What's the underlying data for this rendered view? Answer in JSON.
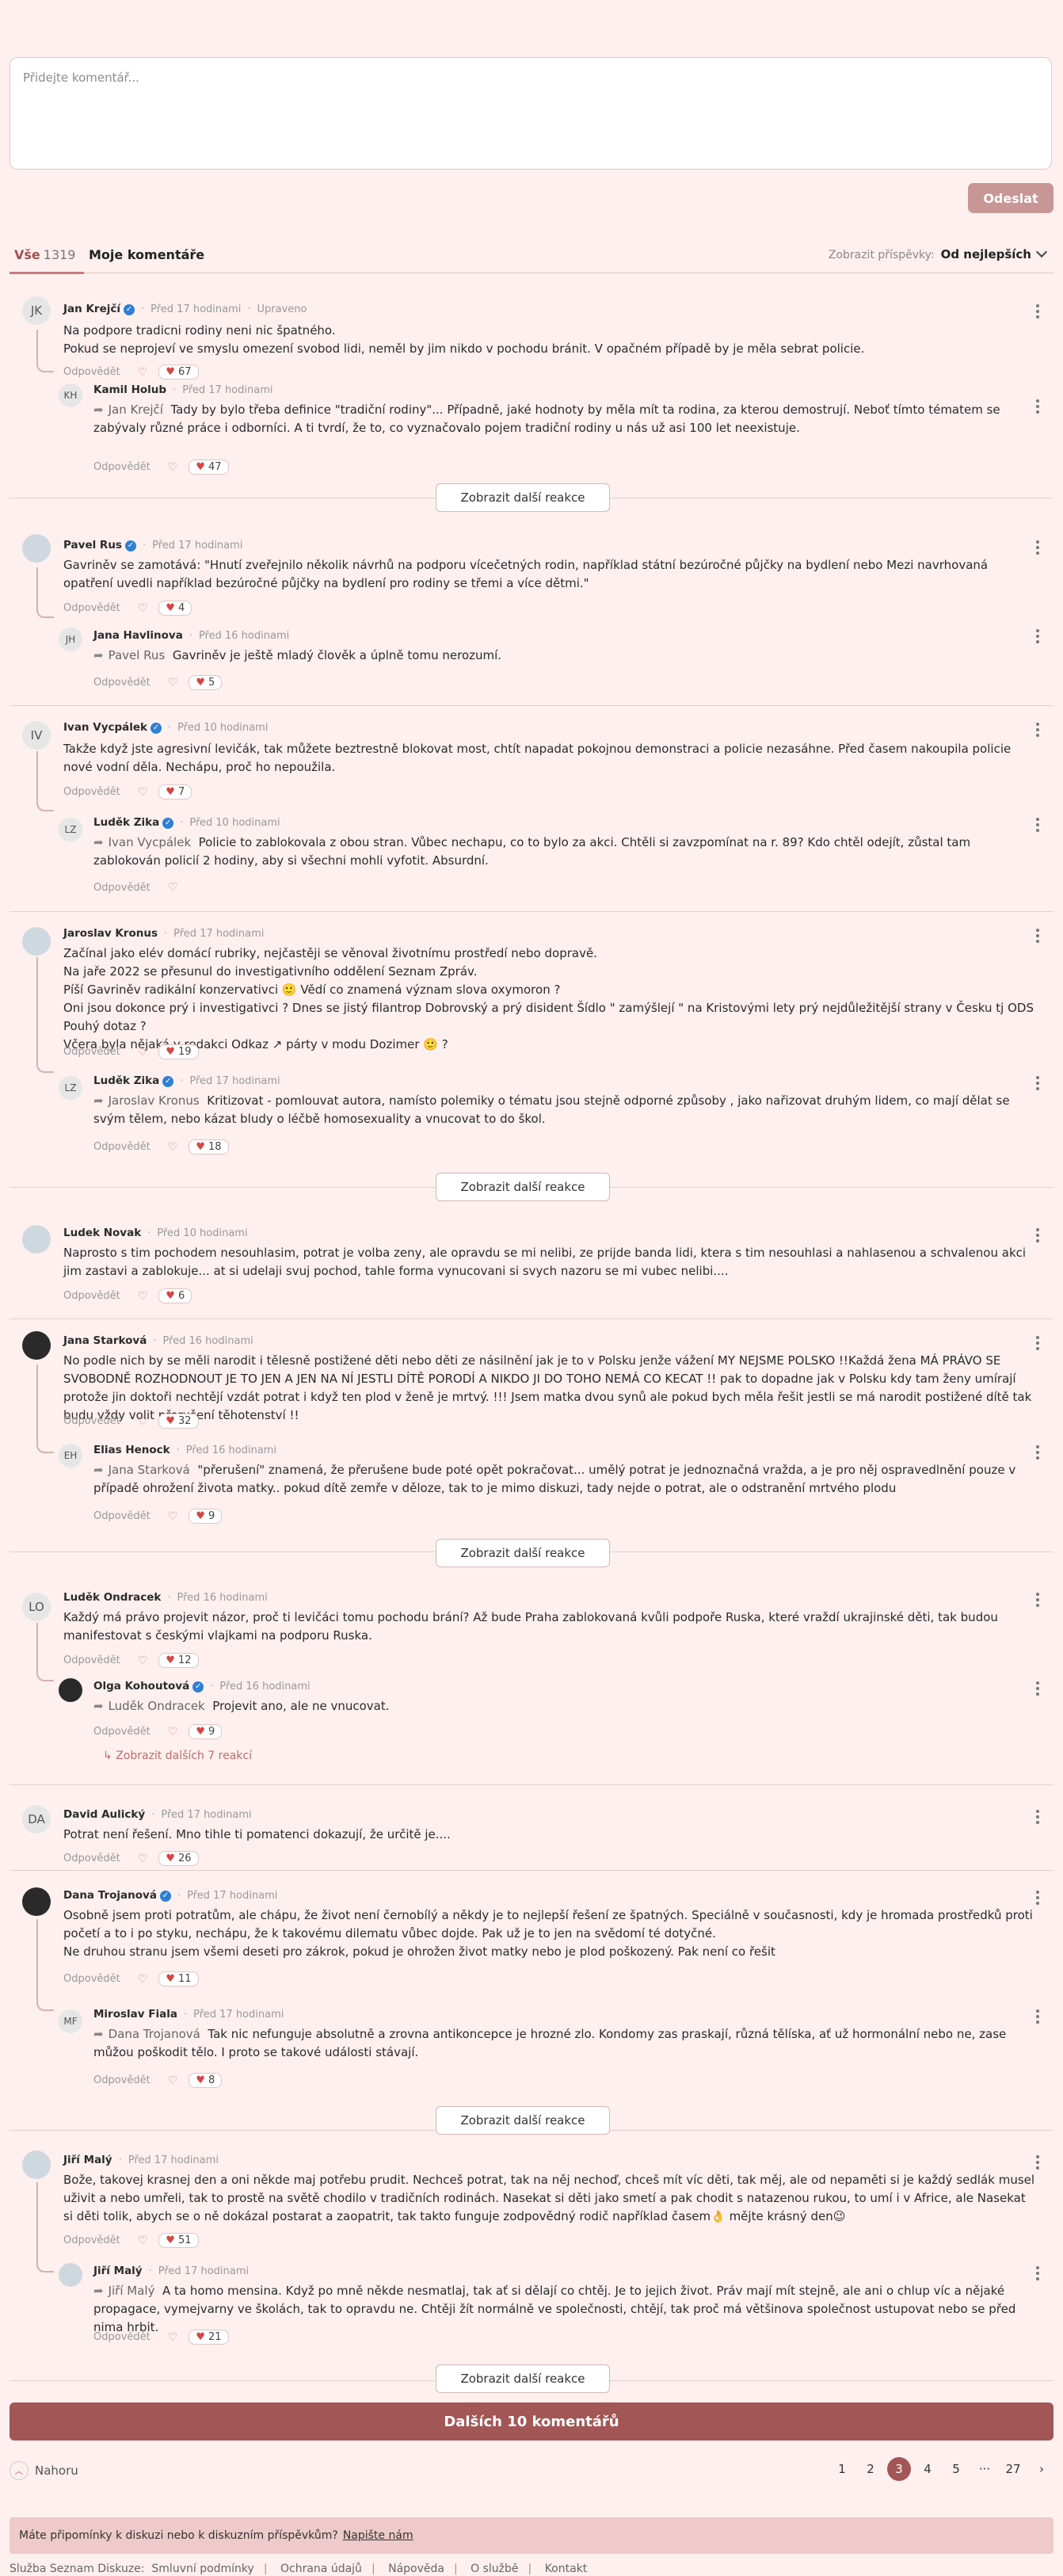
{
  "composer": {
    "placeholder": "Přidejte komentář...",
    "send_label": "Odeslat"
  },
  "tabs": {
    "all_label": "Vše",
    "all_count": "1319",
    "mine_label": "Moje komentáře",
    "sort_label": "Zobrazit příspěvky:",
    "sort_value": "Od nejlepších"
  },
  "common": {
    "reply": "Odpovědět",
    "show_more": "Zobrazit další reakce"
  },
  "threads": [
    {
      "author": "Jan Krejčí",
      "initials": "JK",
      "time": "Před 17 hodinami",
      "edited": "Upraveno",
      "text": [
        "Na podpore tradicni rodiny neni nic špatného.",
        "Pokud se neprojeví ve smyslu omezení svobod lidi, neměl by jim nikdo v pochodu bránit. V opačném případě by je měla sebrat policie."
      ],
      "reactions": "67",
      "reply": {
        "author": "Kamil Holub",
        "initials": "KH",
        "time": "Před 17 hodinami",
        "ref": "Jan Krejčí",
        "text": "Tady by bylo třeba definice \"tradiční rodiny\"... Případně, jaké hodnoty by měla mít ta rodina, za kterou demostrují. Neboť tímto tématem se zabývaly různé práce i odborníci. A ti tvrdí, že to, co vyznačovalo pojem tradiční rodiny u nás už asi 100 let neexistuje.",
        "reactions": "47"
      }
    },
    {
      "author": "Pavel Rus",
      "time": "Před 17 hodinami",
      "text": "Gavriněv se zamotává: \"Hnutí zveřejnilo několik návrhů na podporu vícečetných rodin, například státní bezúročné půjčky na bydlení nebo Mezi navrhovaná opatření uvedli například bezúročné půjčky na bydlení pro rodiny se třemi a více dětmi.\"",
      "reactions": "4",
      "reply": {
        "author": "Jana Havlinova",
        "initials": "JH",
        "time": "Před 16 hodinami",
        "ref": "Pavel Rus",
        "text": "Gavriněv je ještě mladý člověk a úplně tomu nerozumí.",
        "reactions": "5"
      }
    },
    {
      "author": "Ivan Vycpálek",
      "initials": "IV",
      "time": "Před 10 hodinami",
      "text": "Takže když jste agresivní levičák, tak můžete beztrestně blokovat most, chtít napadat pokojnou demonstraci a policie nezasáhne. Před časem nakoupila policie nové vodní děla. Nechápu, proč ho nepoužila.",
      "reactions": "7",
      "reply": {
        "author": "Luděk Zika",
        "initials": "LZ",
        "time": "Před 10 hodinami",
        "ref": "Ivan Vycpálek",
        "text": "Policie to zablokovala z obou stran. Vůbec nechapu, co to bylo za akci. Chtěli si zavzpomínat na r. 89? Kdo chtěl odejít, zůstal tam zablokován policií 2 hodiny, aby si všechni mohli vyfotit. Absurdní."
      }
    },
    {
      "author": "Jaroslav Kronus",
      "time": "Před 17 hodinami",
      "text": [
        "Začínal jako elév domácí rubriky, nejčastěji se věnoval životnímu prostředí nebo dopravě.",
        "Na jaře 2022 se přesunul do investigativního oddělení Seznam Zpráv.",
        "Píší Gavriněv radikální konzervativci 🙂 Vědí co znamená význam slova oxymoron ?",
        "Oni jsou dokonce prý i investigativci ? Dnes se jistý filantrop Dobrovský a prý disident Šídlo \" zamýšlejí \" na Kristovými lety prý nejdůležitější strany v Česku tj ODS Pouhý dotaz ?",
        "Včera byla nějaká v redakci Odkaz ↗ párty v modu Dozimer 🙂 ?"
      ],
      "reactions": "19",
      "reply": {
        "author": "Luděk Zika",
        "initials": "LZ",
        "time": "Před 17 hodinami",
        "ref": "Jaroslav Kronus",
        "text": "Kritizovat - pomlouvat autora, namísto polemiky o tématu jsou stejně odporné způsoby , jako nařizovat druhým lidem, co mají dělat se svým tělem, nebo kázat bludy o léčbě homosexuality a vnucovat to do škol.",
        "reactions": "18"
      }
    },
    {
      "author": "Ludek Novak",
      "time": "Před 10 hodinami",
      "text": "Naprosto s tim pochodem nesouhlasim, potrat je volba zeny, ale opravdu se mi nelibi, ze prijde banda lidi, ktera s tim nesouhlasi a nahlasenou a schvalenou akci jim zastavi a zablokuje... at si udelaji svuj pochod, tahle forma vynucovani si svych nazoru se mi vubec nelibi....",
      "reactions": "6"
    },
    {
      "author": "Jana Starková",
      "time": "Před 16 hodinami",
      "text": "No podle nich by se měli narodit i tělesně postižené děti nebo děti ze násilnění jak je to v Polsku jenže vážení MY NEJSME POLSKO !!Každá žena MÁ PRÁVO SE SVOBODNĚ ROZHODNOUT JE TO JEN A JEN NA NÍ JESTLI DÍTĚ PORODÍ A NIKDO JI DO TOHO NEMÁ CO KECAT !! pak to dopadne jak v Polsku kdy tam ženy umírají protože jin doktoři nechtějí vzdát potrat i když ten plod v ženě je mrtvý. !!! Jsem matka dvou synů ale pokud bych měla řešit jestli se má narodit postižené dítě tak budu vždy volit přerušení těhotenství !!",
      "reactions": "32",
      "reply": {
        "author": "Elias Henock",
        "initials": "EH",
        "time": "Před 16 hodinami",
        "ref": "Jana Starková",
        "text": "\"přerušení\" znamená, že přerušene bude poté opět pokračovat... umělý potrat je jednoznačná vražda, a je pro něj ospravedlnění pouze v případě ohrožení života matky.. pokud dítě zemře v děloze, tak to je mimo diskuzi, tady nejde o potrat, ale o odstranění mrtvého plodu",
        "reactions": "9"
      }
    },
    {
      "author": "Luděk Ondracek",
      "initials": "LO",
      "time": "Před 16 hodinami",
      "text": "Každý má právo projevit názor, proč ti levičáci tomu pochodu brání? Až bude Praha zablokovaná kvůli podpoře Ruska, které vraždí ukrajinské děti, tak budou manifestovat s českými vlajkami na podporu Ruska.",
      "reactions": "12",
      "reply": {
        "author": "Olga Kohoutová",
        "time": "Před 16 hodinami",
        "ref": "Luděk Ondracek",
        "text": "Projevit ano, ale ne vnucovat.",
        "reactions": "9"
      },
      "more_replies": "Zobrazit dalších 7 reakcí"
    },
    {
      "author": "David Aulický",
      "initials": "DA",
      "time": "Před 17 hodinami",
      "text": "Potrat není řešení. Mno tihle ti pomatenci dokazují, že určitě je....",
      "reactions": "26"
    },
    {
      "author": "Dana Trojanová",
      "time": "Před 17 hodinami",
      "text": [
        "Osobně jsem proti potratům, ale chápu, že život není černobílý a někdy je to nejlepší řešení ze špatných. Speciálně v současnosti, kdy je hromada prostředků proti početí a to i po styku, nechápu, že k takovému dilematu vůbec dojde. Pak už je to jen na svědomí té dotyčné.",
        "Ne druhou stranu jsem všemi deseti pro zákrok, pokud je ohrožen život matky nebo je plod poškozený. Pak není co řešit"
      ],
      "reactions": "11",
      "reply": {
        "author": "Miroslav Fiala",
        "initials": "MF",
        "time": "Před 17 hodinami",
        "ref": "Dana Trojanová",
        "text": "Tak nic nefunguje absolutně a zrovna antikoncepce je hrozné zlo. Kondomy zas praskají, různá tělíska, ať už hormonální nebo ne, zase můžou poškodit tělo. I proto se takové události stávají.",
        "reactions": "8"
      }
    },
    {
      "author": "Jiří Malý",
      "time": "Před 17 hodinami",
      "text": "Bože, takovej krasnej den a oni někde maj potřebu prudit. Nechceš potrat, tak na něj nechoď, chceš mít víc děti, tak měj, ale od nepaměti si je každý sedlák musel uživit a nebo umřeli, tak to prostě na světě chodilo v tradičních rodinách. Nasekat si děti jako smetí a pak chodit s natazenou rukou, to umí i v Africe, ale Nasekat si děti tolik, abych se o ně dokázal postarat a zaopatrit, tak takto funguje zodpovědný rodič například časem👌 mějte krásný den😉",
      "reactions": "51",
      "reply": {
        "author": "Jiří Malý",
        "time": "Před 17 hodinami",
        "ref": "Jiří Malý",
        "text": "A ta homo mensina. Když po mně někde nesmatlaj, tak ať si dělají co chtěj. Je to jejich život. Práv mají mít stejně, ale ani o chlup víc a nějaké propagace, vymejvarny ve školách, tak to opravdu ne. Chtěji žít normálně ve společnosti, chtějí, tak proč má většinova společnost ustupovat nebo se před nima hrbit.",
        "reactions": "21"
      }
    }
  ],
  "load_more": "Dalších 10 komentářů",
  "back_to_top": "Nahoru",
  "pagination": [
    "1",
    "2",
    "3",
    "4",
    "5",
    "···",
    "27"
  ],
  "pagination_current": "3",
  "feedback": {
    "text": "Máte připomínky k diskuzi nebo k diskuzním příspěvkům?",
    "link": "Napište nám"
  },
  "footer": [
    "Služba Seznam Diskuze:",
    "Smluvní podmínky",
    "Ochrana údajů",
    "Nápověda",
    "O službě",
    "Kontakt"
  ],
  "colors": {
    "accent": "#a35656",
    "background": "#fdf0ef",
    "verified": "#2e7fd6"
  }
}
